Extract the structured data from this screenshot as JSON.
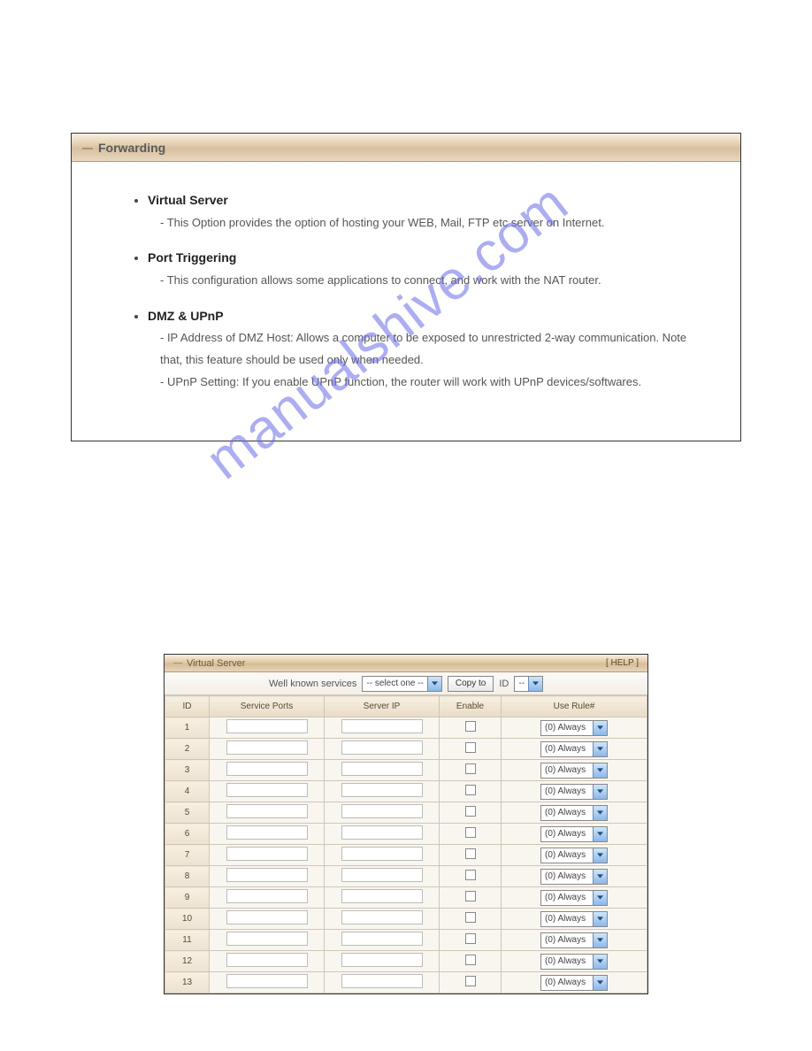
{
  "watermark": "manualshive.com",
  "panel1": {
    "title": "Forwarding",
    "items": [
      {
        "title": "Virtual Server",
        "descs": [
          "- This Option provides the option of hosting your WEB, Mail, FTP etc server on Internet."
        ]
      },
      {
        "title": "Port Triggering",
        "descs": [
          "- This configuration allows some applications to connect, and work with the NAT router."
        ]
      },
      {
        "title": "DMZ & UPnP",
        "descs": [
          "- IP Address of DMZ Host: Allows a computer to be exposed to unrestricted 2-way communication. Note that, this feature should be used only when needed.",
          "- UPnP Setting: If you enable UPnP function, the router will work with UPnP devices/softwares."
        ]
      }
    ]
  },
  "panel2": {
    "title": "Virtual Server",
    "help": "[ HELP ]",
    "toolbar": {
      "wks_label": "Well known services",
      "wks_value": "-- select one --",
      "copy_label": "Copy to",
      "id_label": "ID",
      "id_value": "--"
    },
    "columns": {
      "id": "ID",
      "ports": "Service Ports",
      "ip": "Server IP",
      "enable": "Enable",
      "rule": "Use Rule#"
    },
    "rule_value": "(0) Always",
    "rows": [
      1,
      2,
      3,
      4,
      5,
      6,
      7,
      8,
      9,
      10,
      11,
      12,
      13
    ]
  }
}
